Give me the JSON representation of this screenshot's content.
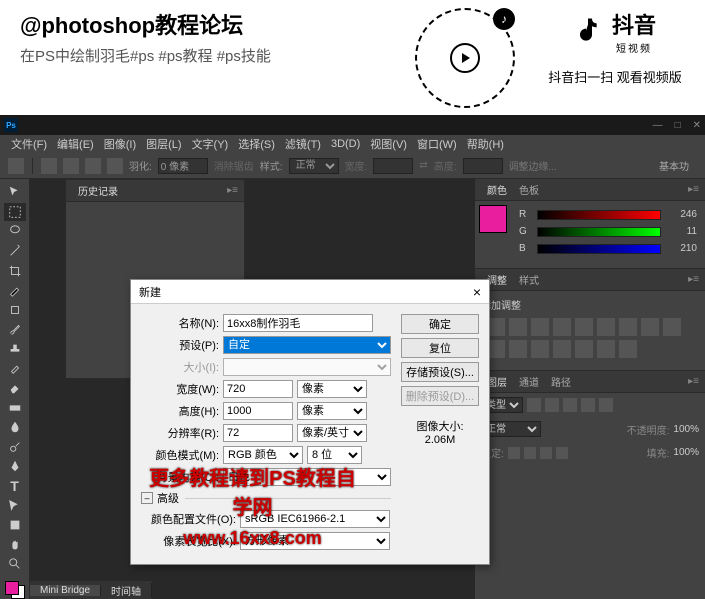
{
  "header": {
    "title": "@photoshop教程论坛",
    "subtitle": "在PS中绘制羽毛#ps #ps教程 #ps技能",
    "douyin_name": "抖音",
    "douyin_sub": "短视频",
    "douyin_caption": "抖音扫一扫 观看视频版"
  },
  "ps": {
    "logo": "Ps",
    "menubar": [
      "文件(F)",
      "编辑(E)",
      "图像(I)",
      "图层(L)",
      "文字(Y)",
      "选择(S)",
      "滤镜(T)",
      "3D(D)",
      "视图(V)",
      "窗口(W)",
      "帮助(H)"
    ],
    "options": {
      "feather_label": "羽化:",
      "feather_val": "0 像素",
      "antialias": "消除锯齿",
      "style_label": "样式:",
      "style_val": "正常",
      "width_label": "宽度:",
      "height_label": "高度:",
      "refine": "调整边缘...",
      "workspace": "基本功"
    },
    "history_panel": "历史记录",
    "color_panel": {
      "tab1": "颜色",
      "tab2": "色板",
      "r": "R",
      "r_val": "246",
      "g": "G",
      "g_val": "11",
      "b": "B",
      "b_val": "210"
    },
    "adjust_panel": {
      "tab1": "调整",
      "tab2": "样式",
      "add_label": "添加调整"
    },
    "layers_panel": {
      "tab1": "图层",
      "tab2": "通道",
      "tab3": "路径",
      "kind": "类型",
      "blend": "正常",
      "opacity_label": "不透明度:",
      "opacity_val": "100%",
      "lock_label": "锁定:",
      "fill_label": "填充:",
      "fill_val": "100%"
    },
    "bottom": {
      "mini_bridge": "Mini Bridge",
      "timeline": "时间轴"
    }
  },
  "dialog": {
    "title": "新建",
    "name_label": "名称(N):",
    "name_val": "16xx8制作羽毛",
    "preset_label": "预设(P):",
    "preset_val": "自定",
    "size_label": "大小(I):",
    "width_label": "宽度(W):",
    "width_val": "720",
    "width_unit": "像素",
    "height_label": "高度(H):",
    "height_val": "1000",
    "height_unit": "像素",
    "res_label": "分辨率(R):",
    "res_val": "72",
    "res_unit": "像素/英寸",
    "mode_label": "颜色模式(M):",
    "mode_val": "RGB 颜色",
    "mode_bits": "8 位",
    "bg_label": "背景内容(C):",
    "bg_val": "白色",
    "advanced": "高级",
    "profile_label": "颜色配置文件(O):",
    "profile_val": "sRGB IEC61966-2.1",
    "aspect_label": "像素长宽比(X):",
    "aspect_val": "方形像素",
    "ok": "确定",
    "cancel": "复位",
    "save_preset": "存储预设(S)...",
    "delete_preset": "删除预设(D)...",
    "img_size_label": "图像大小:",
    "img_size_val": "2.06M"
  },
  "watermark": {
    "text": "更多教程请到PS教程自学网",
    "url": "www.16xx8.com"
  }
}
